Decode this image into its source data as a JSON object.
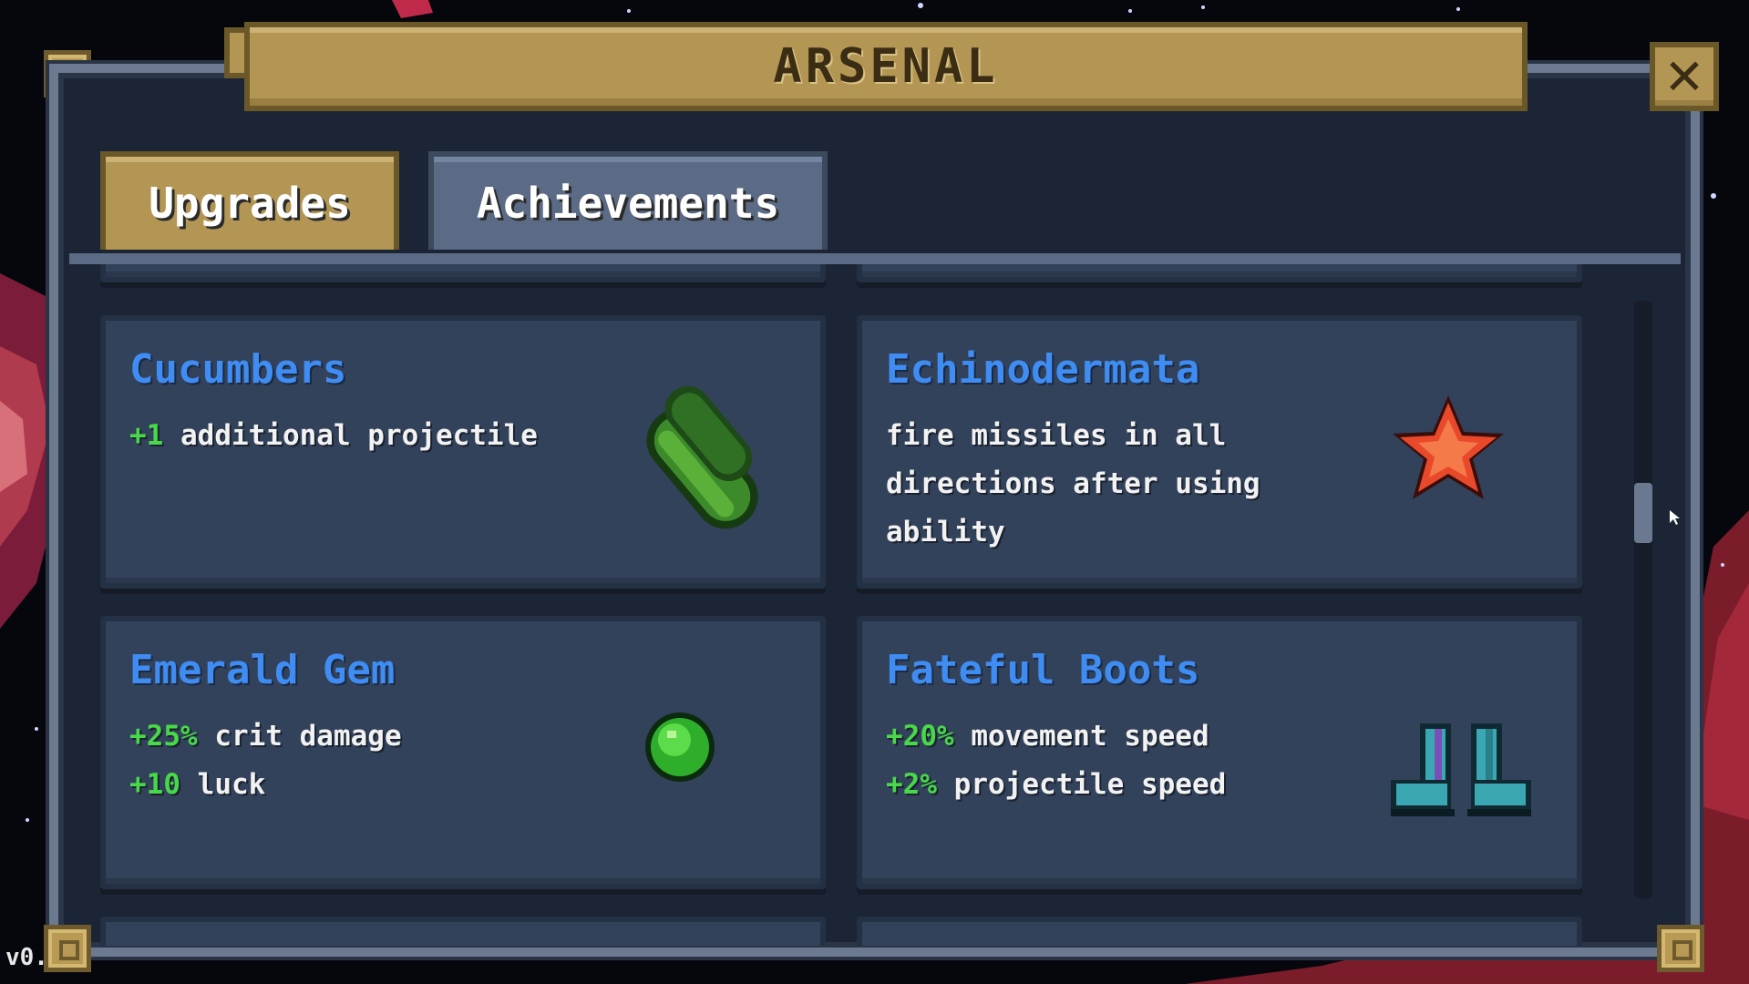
{
  "window": {
    "title": "ARSENAL",
    "close_label": "✕"
  },
  "tabs": [
    {
      "label": "Upgrades",
      "active": true
    },
    {
      "label": "Achievements",
      "active": false
    }
  ],
  "cards": [
    {
      "title": "Cucumbers",
      "lines": [
        {
          "value": "+1",
          "text": " additional projectile"
        }
      ],
      "icon": "cucumber-icon"
    },
    {
      "title": "Echinodermata",
      "lines": [
        {
          "value": "",
          "text": "fire missiles in all"
        },
        {
          "value": "",
          "text": "directions after using"
        },
        {
          "value": "",
          "text": "ability"
        }
      ],
      "icon": "starfish-icon"
    },
    {
      "title": "Emerald Gem",
      "lines": [
        {
          "value": "+25%",
          "text": " crit damage"
        },
        {
          "value": "+10",
          "text": " luck"
        }
      ],
      "icon": "emerald-gem-icon"
    },
    {
      "title": "Fateful Boots",
      "lines": [
        {
          "value": "+20%",
          "text": " movement speed"
        },
        {
          "value": "+2%",
          "text": " projectile speed"
        }
      ],
      "icon": "boots-icon"
    }
  ],
  "scrollbar": {
    "position": 0.35
  },
  "version": "v0.",
  "colors": {
    "title_blue": "#3f8cf2",
    "stat_green": "#49d84a",
    "gold": "#b39654",
    "panel": "#32425a"
  }
}
